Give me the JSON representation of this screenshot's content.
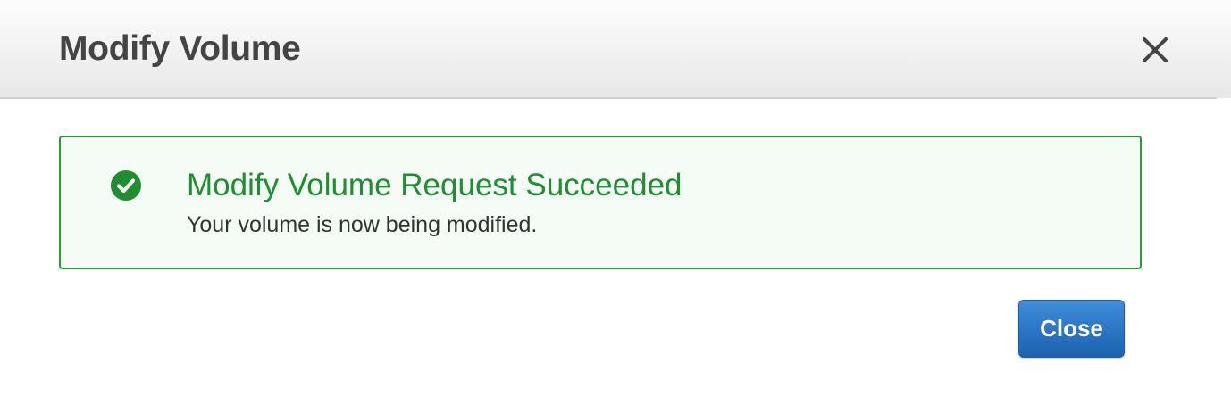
{
  "dialog": {
    "title": "Modify Volume",
    "close_icon": "close-icon"
  },
  "alert": {
    "icon": "check-circle-icon",
    "title": "Modify Volume Request Succeeded",
    "message": "Your volume is now being modified.",
    "colors": {
      "accent": "#1d8f2f",
      "border": "#2d9a3f",
      "background": "#f4fcf5"
    }
  },
  "footer": {
    "close_label": "Close",
    "button_color": "#2a74c4"
  }
}
